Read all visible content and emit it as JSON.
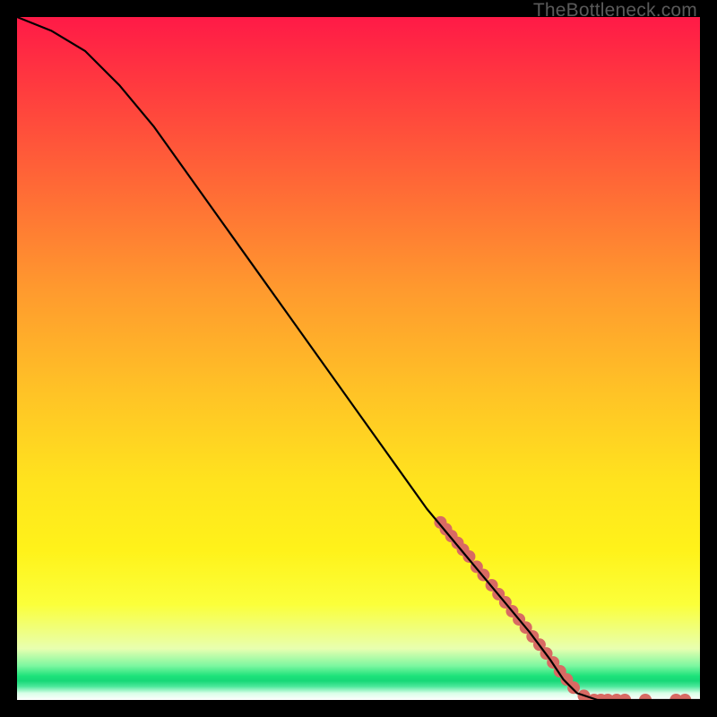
{
  "watermark": "TheBottleneck.com",
  "chart_data": {
    "type": "line",
    "title": "",
    "xlabel": "",
    "ylabel": "",
    "xlim": [
      0,
      100
    ],
    "ylim": [
      0,
      100
    ],
    "grid": false,
    "legend": false,
    "series": [
      {
        "name": "curve",
        "color": "#000000",
        "x": [
          0,
          5,
          10,
          15,
          20,
          25,
          30,
          35,
          40,
          45,
          50,
          55,
          60,
          65,
          70,
          75,
          78,
          80,
          82,
          85,
          90,
          95,
          100
        ],
        "y": [
          100,
          98,
          95,
          90,
          84,
          77,
          70,
          63,
          56,
          49,
          42,
          35,
          28,
          22,
          16,
          10,
          6,
          3,
          1,
          0,
          0,
          0,
          0
        ]
      }
    ],
    "markers": [
      {
        "name": "highlight-dots",
        "color": "#d86a63",
        "radius_px": 7,
        "points": [
          {
            "x": 62.0,
            "y": 26.0
          },
          {
            "x": 62.8,
            "y": 25.0
          },
          {
            "x": 63.6,
            "y": 24.0
          },
          {
            "x": 64.5,
            "y": 23.0
          },
          {
            "x": 65.3,
            "y": 22.0
          },
          {
            "x": 66.2,
            "y": 21.0
          },
          {
            "x": 67.3,
            "y": 19.5
          },
          {
            "x": 68.3,
            "y": 18.3
          },
          {
            "x": 69.5,
            "y": 16.8
          },
          {
            "x": 70.5,
            "y": 15.5
          },
          {
            "x": 71.5,
            "y": 14.3
          },
          {
            "x": 72.5,
            "y": 13.0
          },
          {
            "x": 73.5,
            "y": 11.8
          },
          {
            "x": 74.5,
            "y": 10.6
          },
          {
            "x": 75.5,
            "y": 9.3
          },
          {
            "x": 76.5,
            "y": 8.1
          },
          {
            "x": 77.5,
            "y": 6.8
          },
          {
            "x": 78.5,
            "y": 5.5
          },
          {
            "x": 79.5,
            "y": 4.2
          },
          {
            "x": 80.5,
            "y": 3.0
          },
          {
            "x": 81.5,
            "y": 1.8
          },
          {
            "x": 83.0,
            "y": 0.6
          },
          {
            "x": 84.5,
            "y": 0.0
          },
          {
            "x": 85.5,
            "y": 0.0
          },
          {
            "x": 86.5,
            "y": 0.0
          },
          {
            "x": 87.8,
            "y": 0.0
          },
          {
            "x": 89.0,
            "y": 0.0
          },
          {
            "x": 92.0,
            "y": 0.0
          },
          {
            "x": 96.5,
            "y": 0.0
          },
          {
            "x": 97.8,
            "y": 0.0
          }
        ]
      }
    ]
  }
}
